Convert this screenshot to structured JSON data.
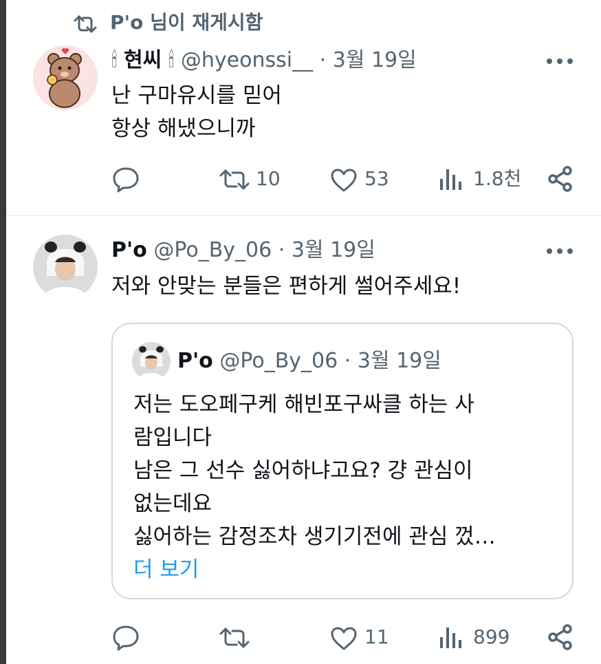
{
  "retweet_banner": {
    "text": "P'o 님이 재게시함"
  },
  "tweet1": {
    "name_prefix_emoji": "🕯",
    "name": "현씨",
    "name_suffix_emoji": "🕯",
    "handle": "@hyeonssi__",
    "dot": "·",
    "date": "3월 19일",
    "lines": [
      "난 구마유시를 믿어",
      "항상 해냈으니까"
    ],
    "actions": {
      "replies": "",
      "reposts": "10",
      "likes": "53",
      "views": "1.8천"
    }
  },
  "tweet2": {
    "name": "P'o",
    "handle": "@Po_By_06",
    "dot": "·",
    "date": "3월 19일",
    "text": "저와 안맞는 분들은 편하게 썰어주세요!",
    "quote": {
      "name": "P'o",
      "handle": "@Po_By_06",
      "dot": "·",
      "date": "3월 19일",
      "lines": [
        "저는 도오페구케 해빈포구싸클 하는 사",
        "람입니다",
        "남은 그 선수 싫어하냐고요? 걍 관심이",
        "없는데요",
        "싫어하는 감정조차 생기기전에 관심 껐…"
      ],
      "more": "더 보기"
    },
    "actions": {
      "replies": "",
      "reposts": "",
      "likes": "11",
      "views": "899"
    }
  },
  "colors": {
    "accent": "#1d9bf0",
    "secondary_text": "#536471",
    "border": "#cfd9de"
  }
}
